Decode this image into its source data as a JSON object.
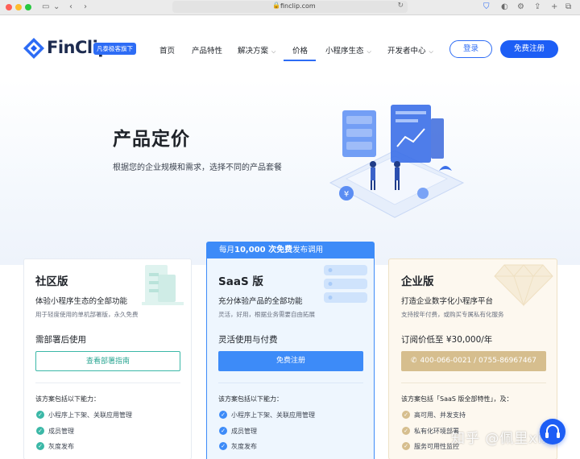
{
  "browser": {
    "url": "finclip.com"
  },
  "header": {
    "logo_text": "FinClip",
    "logo_badge": "凡泰极客旗下",
    "nav": [
      {
        "label": "首页"
      },
      {
        "label": "产品特性"
      },
      {
        "label": "解决方案"
      },
      {
        "label": "价格"
      },
      {
        "label": "小程序生态"
      },
      {
        "label": "开发者中心"
      }
    ],
    "login_label": "登录",
    "register_label": "免费注册",
    "accent_color": "#1d5ef5"
  },
  "hero": {
    "title": "产品定价",
    "subtitle": "根据您的企业规模和需求，选择不同的产品套餐"
  },
  "plans": [
    {
      "name": "社区版",
      "slogan": "体验小程序生态的全部功能",
      "desc": "用于轻度使用的单机部署版，永久免费",
      "price": "需部署后使用",
      "button": "查看部署指南",
      "includes": "该方案包括以下能力：",
      "features": [
        "小程序上下架、关联应用管理",
        "成员管理",
        "灰度发布"
      ],
      "color": "#3bb8a7"
    },
    {
      "banner_prefix": "每月",
      "banner_highlight": "10,000 次免费",
      "banner_suffix": "发布调用",
      "name": "SaaS 版",
      "slogan": "充分体验产品的全部功能",
      "desc": "灵活，好用，根据业务需要自由拓展",
      "price": "灵活使用与付费",
      "button": "免费注册",
      "includes": "该方案包括以下能力：",
      "features": [
        "小程序上下架、关联应用管理",
        "成员管理",
        "灰度发布"
      ],
      "color": "#3d8bf8"
    },
    {
      "name": "企业版",
      "slogan": "打造企业数字化小程序平台",
      "desc": "支持按年付费，或购买专属私有化服务",
      "price": "订阅价低至 ¥30,000/年",
      "button": "400-066-0021 / 0755-86967467",
      "includes": "该方案包括「SaaS 版全部特性」，及：",
      "features": [
        "高可用、并发支持",
        "私有化环境部署",
        "服务可用性监控"
      ],
      "color": "#d6be8e"
    }
  ],
  "watermark": "知乎 @佩里xixi"
}
